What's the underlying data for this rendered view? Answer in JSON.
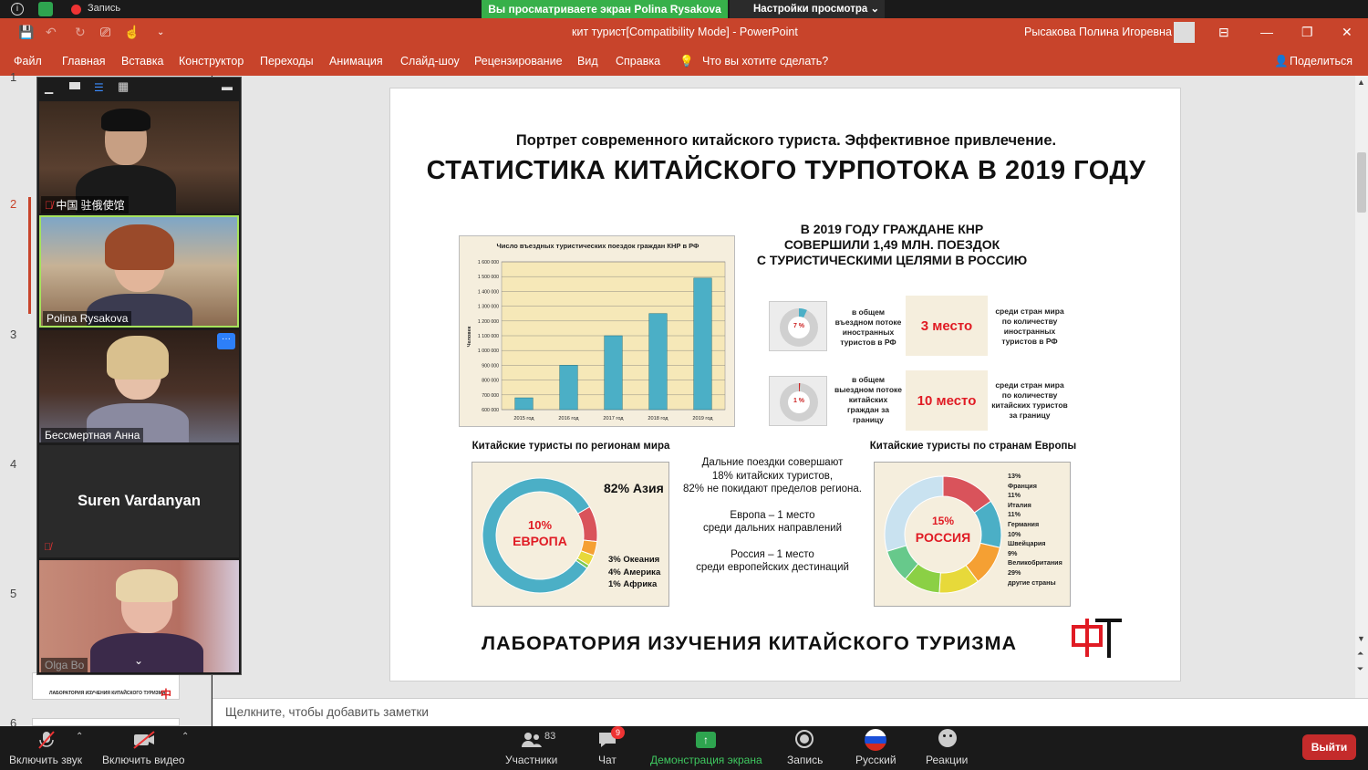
{
  "zoom_top": {
    "record_label": "Запись",
    "share_banner": "Вы просматриваете экран Polina Rysakova",
    "view_options": "Настройки просмотра"
  },
  "ppt": {
    "doc_title": "кит турист[Compatibility Mode]  -  PowerPoint",
    "user_name": "Рысакова Полина Игоревна",
    "menu": [
      "Файл",
      "Главная",
      "Вставка",
      "Конструктор",
      "Переходы",
      "Анимация",
      "Слайд-шоу",
      "Рецензирование",
      "Вид",
      "Справка"
    ],
    "tell_me": "Что вы хотите сделать?",
    "share": "Поделиться",
    "notes_placeholder": "Щелкните, чтобы добавить заметки",
    "slide_numbers": [
      "1",
      "2",
      "3",
      "4",
      "5",
      "6"
    ]
  },
  "thumb5_caption": "ЛАБОРАТОРИЯ ИЗУЧЕНИЯ КИТАЙСКОГО ТУРИЗМА",
  "slide": {
    "subtitle": "Портрет современного китайского туриста. Эффективное привлечение.",
    "title": "СТАТИСТИКА КИТАЙСКОГО ТУРПОТОКА В 2019 ГОДУ",
    "summary_l1": "В 2019 ГОДУ ГРАЖДАНЕ КНР",
    "summary_l2": "СОВЕРШИЛИ 1,49 МЛН. ПОЕЗДОК",
    "summary_l3": "С ТУРИСТИЧЕСКИМИ ЦЕЛЯМИ В РОССИЮ",
    "stat1": {
      "pct": "7 %",
      "left_l1": "в общем",
      "left_l2": "въездном потоке",
      "left_l3": "иностранных",
      "left_l4": "туристов в РФ",
      "place": "3 место",
      "right_l1": "среди стран мира",
      "right_l2": "по количеству",
      "right_l3": "иностранных",
      "right_l4": "туристов в РФ"
    },
    "stat2": {
      "pct": "1 %",
      "left_l1": "в общем",
      "left_l2": "выездном потоке",
      "left_l3": "китайских",
      "left_l4": "граждан за",
      "left_l5": "границу",
      "place": "10 место",
      "right_l1": "среди стран мира",
      "right_l2": "по количеству",
      "right_l3": "китайских туристов",
      "right_l4": "за границу"
    },
    "regions_title": "Китайские туристы по регионам мира",
    "europe_title": "Китайские туристы по странам Европы",
    "middle_l1": "Дальние поездки совершают",
    "middle_l2": "18% китайских туристов,",
    "middle_l3": "82% не покидают пределов региона.",
    "middle_l4": "Европа – 1 место",
    "middle_l5": "среди дальних направлений",
    "middle_l6": "Россия – 1 место",
    "middle_l7": "среди европейских дестинаций",
    "footer": "ЛАБОРАТОРИЯ ИЗУЧЕНИЯ КИТАЙСКОГО ТУРИЗМА"
  },
  "chart_data": [
    {
      "type": "bar",
      "title": "Число въездных туристических поездок граждан КНР в РФ",
      "ylabel": "Человек",
      "categories": [
        "2015 год",
        "2016 год",
        "2017 год",
        "2018 год",
        "2019 год"
      ],
      "values": [
        680000,
        900000,
        1100000,
        1250000,
        1490000
      ],
      "ylim": [
        600000,
        1600000
      ],
      "yticks": [
        "600 000",
        "700 000",
        "800 000",
        "900 000",
        "1 000 000",
        "1 100 000",
        "1 200 000",
        "1 300 000",
        "1 400 000",
        "1 500 000",
        "1 600 000"
      ],
      "color": "#4bafc6",
      "grid": true
    },
    {
      "type": "pie",
      "title": "Китайские туристы по регионам мира",
      "center_label_pct": "10%",
      "center_label": "ЕВРОПА",
      "annotation_top": "82% Азия",
      "annotation_l1": "3% Океания",
      "annotation_l2": "4% Америка",
      "annotation_l3": "1% Африка",
      "values": [
        82,
        10,
        3,
        4,
        1
      ],
      "colors": [
        "#4bafc6",
        "#d9535b",
        "#f5a033",
        "#e7d93a",
        "#7ec850"
      ]
    },
    {
      "type": "pie",
      "title": "Китайские туристы по странам Европы",
      "center_label_pct": "15%",
      "center_label": "РОССИЯ",
      "legend_l1": "13%",
      "legend_l2": "Франция",
      "legend_l3": "11%",
      "legend_l4": "Италия",
      "legend_l5": "11%",
      "legend_l6": "Германия",
      "legend_l7": "10%",
      "legend_l8": "Швейцария",
      "legend_l9": "9%",
      "legend_l10": "Великобритания",
      "legend_l11": "29%",
      "legend_l12": "другие страны",
      "values": [
        15,
        13,
        11,
        11,
        10,
        9,
        29
      ],
      "colors": [
        "#d9535b",
        "#4bafc6",
        "#f5a033",
        "#e7d93a",
        "#8bd045",
        "#67c98b",
        "#c9e2f0"
      ]
    }
  ],
  "participants": [
    {
      "name": "中国 驻俄使馆",
      "muted": true
    },
    {
      "name": "Polina Rysakova",
      "muted": false
    },
    {
      "name": "Бессмертная Анна",
      "muted": false
    },
    {
      "name": "Suren Vardanyan",
      "muted": true
    },
    {
      "name": "Olga Bo",
      "muted": false
    }
  ],
  "zoom_bottom": {
    "mute": "Включить звук",
    "video": "Включить видео",
    "participants": "Участники",
    "participants_count": "83",
    "chat": "Чат",
    "chat_badge": "9",
    "share": "Демонстрация экрана",
    "record": "Запись",
    "language": "Русский",
    "reactions": "Реакции",
    "leave": "Выйти"
  }
}
